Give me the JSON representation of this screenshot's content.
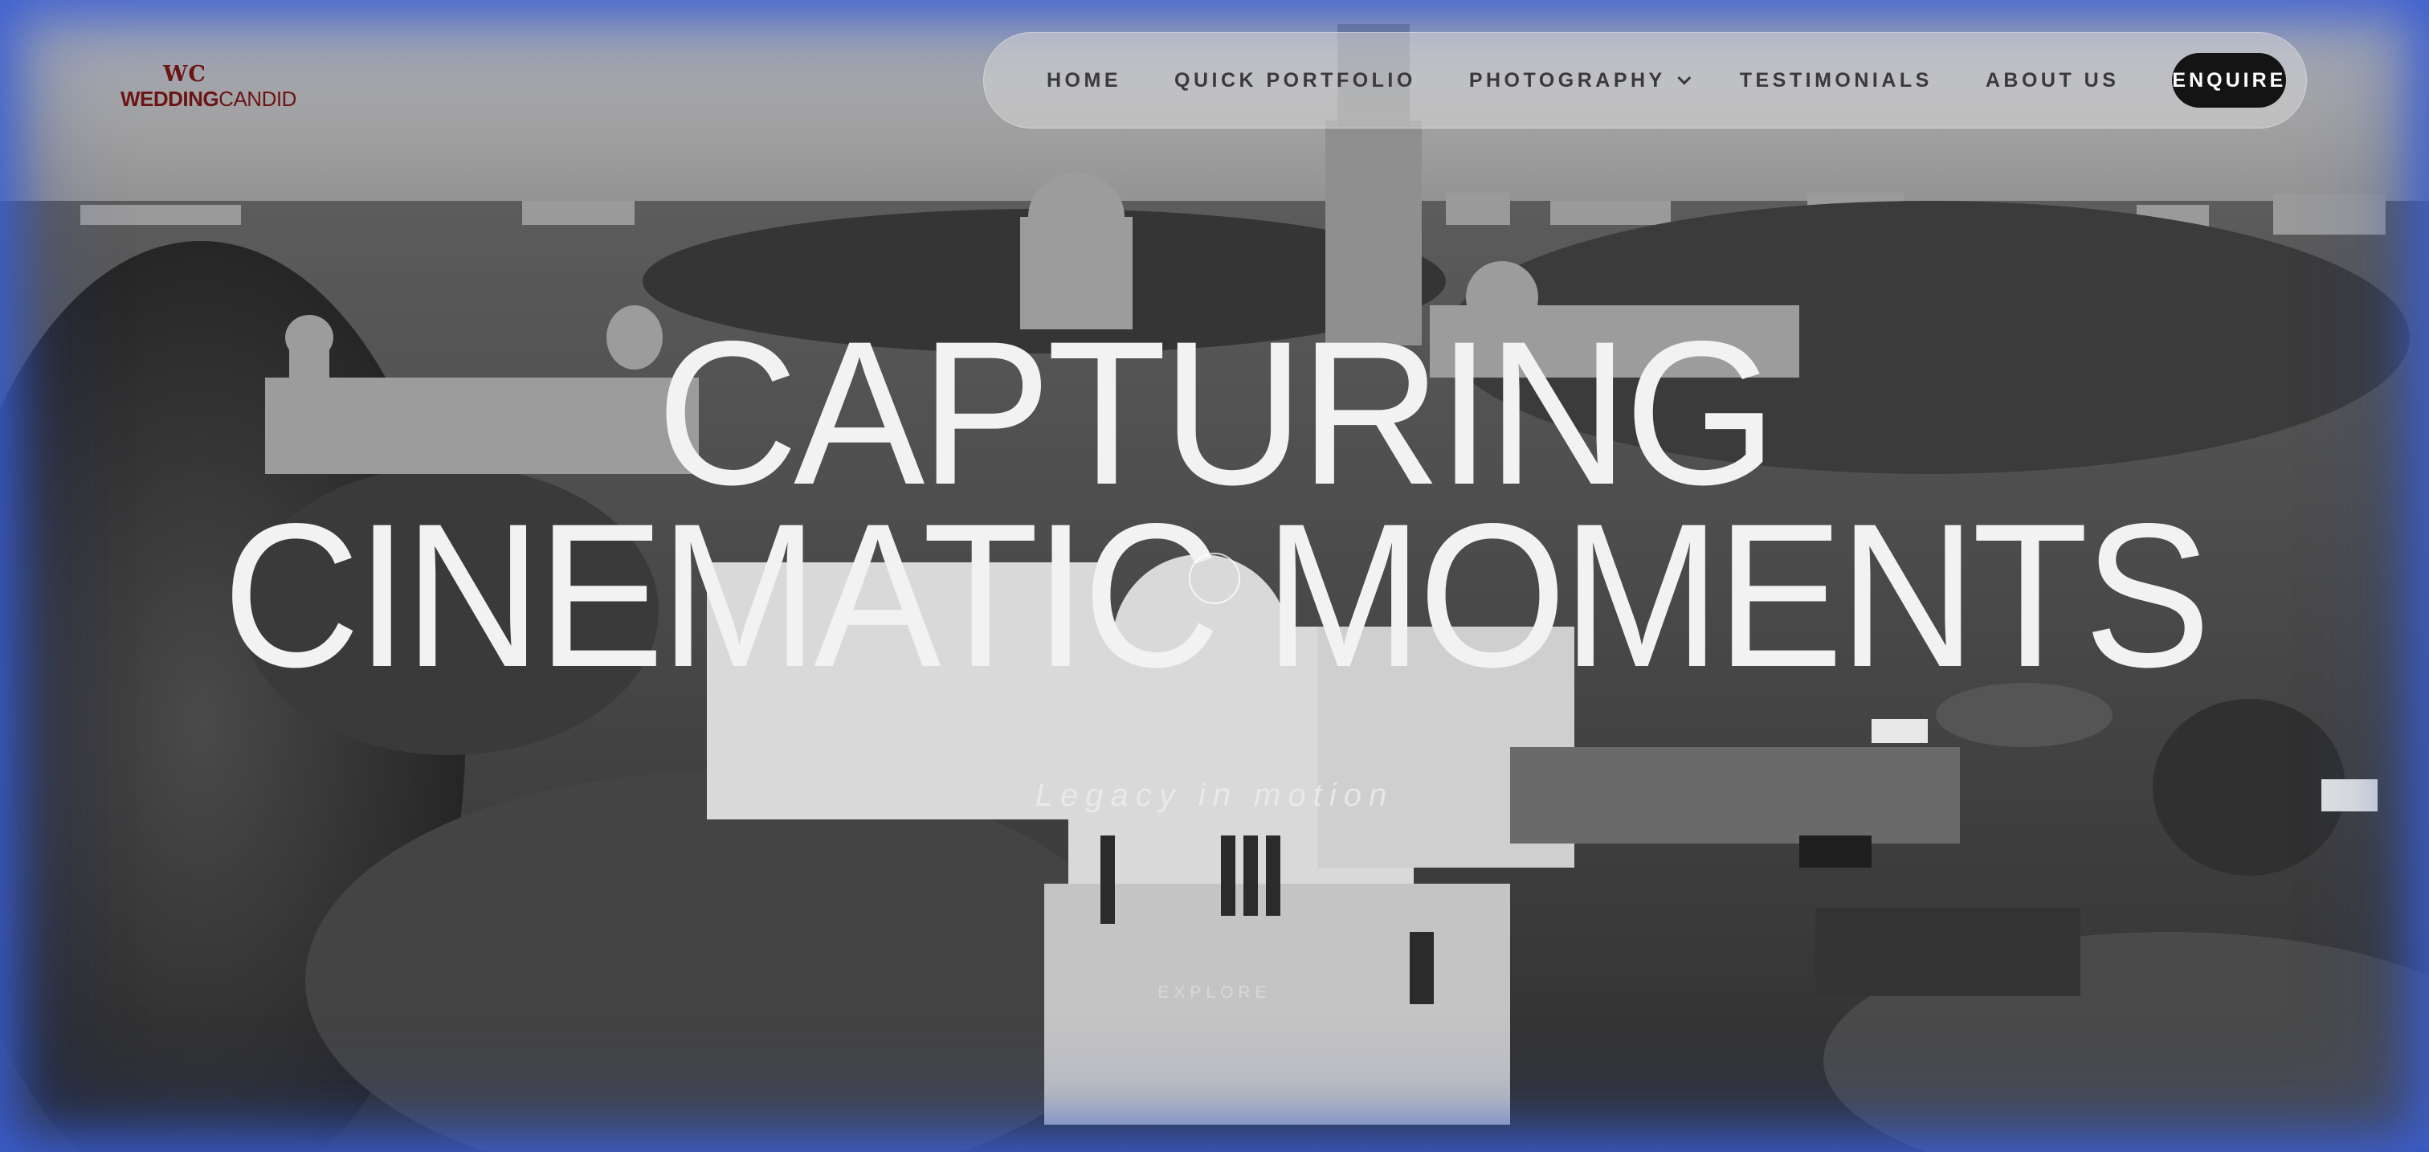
{
  "logo": {
    "monogram": "WC",
    "wordmark_bold": "WEDDING",
    "wordmark_light": "CANDID",
    "color": "#6b1414"
  },
  "nav": {
    "items": [
      {
        "label": "HOME"
      },
      {
        "label": "QUICK PORTFOLIO"
      },
      {
        "label": "PHOTOGRAPHY",
        "has_dropdown": true
      },
      {
        "label": "TESTIMONIALS"
      },
      {
        "label": "ABOUT US"
      }
    ],
    "cta_label": "ENQUIRE",
    "cta_color": "#141414"
  },
  "hero": {
    "line1": "CAPTURING",
    "line2": "CINEMATIC MOMENTS",
    "tagline": "Legacy in motion",
    "explore_label": "EXPLORE",
    "background": "black-and-white aerial photo of palace",
    "frame_glow_color": "#3c5fd2"
  }
}
